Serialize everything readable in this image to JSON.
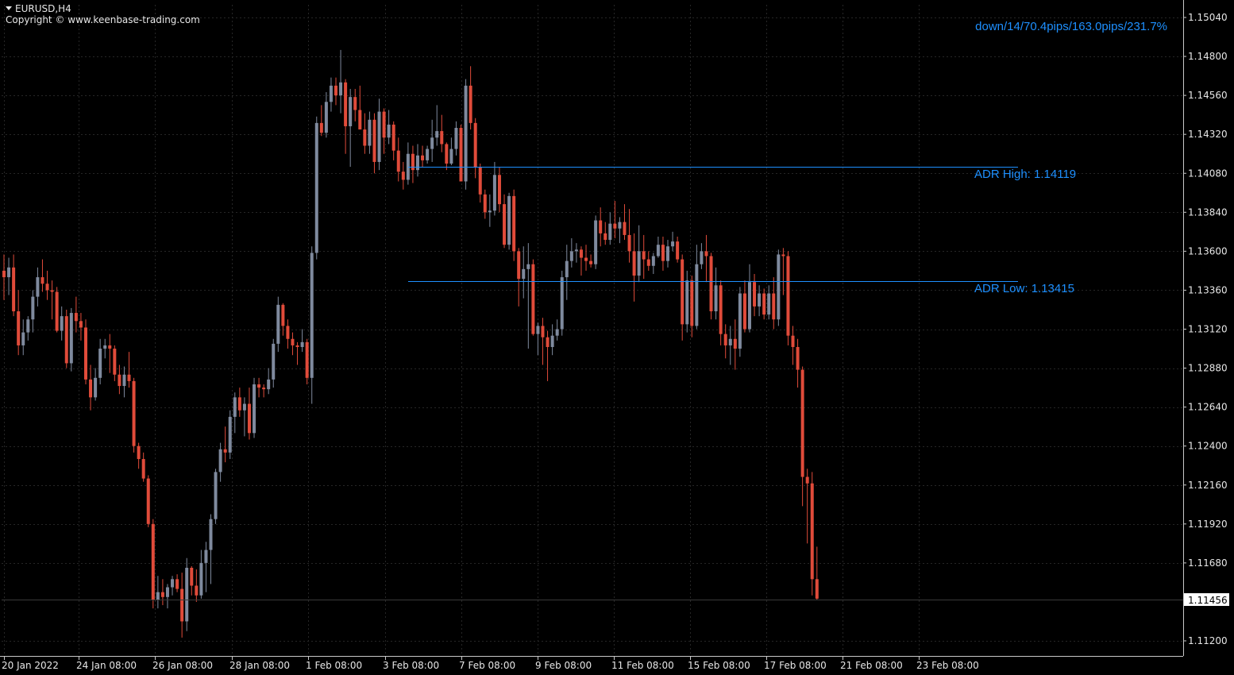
{
  "header": {
    "symbol_label": "EURUSD,H4",
    "copyright": "Copyright © www.keenbase-trading.com"
  },
  "indicator": {
    "status": "down/14/70.4pips/163.0pips/231.7%",
    "adr_high_label": "ADR High: 1.14119",
    "adr_low_label": "ADR Low: 1.13415",
    "adr_high": 1.14119,
    "adr_low": 1.13415
  },
  "current_price": "1.11456",
  "colors": {
    "background": "#000000",
    "grid": "#262626",
    "axis": "#c8c8c8",
    "text": "#e6e6e6",
    "bull": "#7f8a9e",
    "bear": "#e04b3a",
    "adr": "#1e90ff"
  },
  "chart_data": {
    "type": "candlestick",
    "symbol": "EURUSD",
    "timeframe": "H4",
    "ylim": [
      1.1112,
      1.1514
    ],
    "y_ticks": [
      "1.15040",
      "1.14800",
      "1.14560",
      "1.14320",
      "1.14080",
      "1.13840",
      "1.13600",
      "1.13360",
      "1.13120",
      "1.12880",
      "1.12640",
      "1.12400",
      "1.12160",
      "1.11920",
      "1.11680",
      "1.11200"
    ],
    "x_ticks": [
      "20 Jan 2022",
      "24 Jan 08:00",
      "26 Jan 08:00",
      "28 Jan 08:00",
      "1 Feb 08:00",
      "3 Feb 08:00",
      "7 Feb 08:00",
      "9 Feb 08:00",
      "11 Feb 08:00",
      "15 Feb 08:00",
      "17 Feb 08:00",
      "21 Feb 08:00",
      "23 Feb 08:00"
    ],
    "candles": [
      [
        1.1348,
        1.1358,
        1.133,
        1.1344
      ],
      [
        1.1344,
        1.1356,
        1.1333,
        1.135
      ],
      [
        1.135,
        1.1358,
        1.132,
        1.1323
      ],
      [
        1.1323,
        1.1336,
        1.1296,
        1.1302
      ],
      [
        1.1302,
        1.1318,
        1.1296,
        1.131
      ],
      [
        1.131,
        1.132,
        1.1305,
        1.1318
      ],
      [
        1.1318,
        1.1336,
        1.131,
        1.1332
      ],
      [
        1.1332,
        1.135,
        1.1326,
        1.1344
      ],
      [
        1.1344,
        1.1355,
        1.1335,
        1.134
      ],
      [
        1.134,
        1.1348,
        1.133,
        1.1336
      ],
      [
        1.1336,
        1.1342,
        1.1318,
        1.1335
      ],
      [
        1.1335,
        1.1338,
        1.131,
        1.1311
      ],
      [
        1.1311,
        1.1326,
        1.1305,
        1.132
      ],
      [
        1.132,
        1.1324,
        1.1288,
        1.1291
      ],
      [
        1.1291,
        1.1325,
        1.1286,
        1.1322
      ],
      [
        1.1322,
        1.1332,
        1.131,
        1.1317
      ],
      [
        1.1317,
        1.1322,
        1.1305,
        1.1313
      ],
      [
        1.1313,
        1.1318,
        1.1278,
        1.1281
      ],
      [
        1.1281,
        1.129,
        1.1262,
        1.127
      ],
      [
        1.127,
        1.1288,
        1.1268,
        1.1282
      ],
      [
        1.1282,
        1.1306,
        1.1278,
        1.13
      ],
      [
        1.13,
        1.1306,
        1.1294,
        1.1302
      ],
      [
        1.1302,
        1.1309,
        1.1285,
        1.13
      ],
      [
        1.13,
        1.1302,
        1.128,
        1.1284
      ],
      [
        1.1284,
        1.129,
        1.1272,
        1.1277
      ],
      [
        1.1277,
        1.1289,
        1.127,
        1.1284
      ],
      [
        1.1284,
        1.1298,
        1.1276,
        1.128
      ],
      [
        1.128,
        1.1282,
        1.1236,
        1.124
      ],
      [
        1.124,
        1.1242,
        1.1226,
        1.1232
      ],
      [
        1.1232,
        1.1236,
        1.1218,
        1.122
      ],
      [
        1.122,
        1.1222,
        1.119,
        1.1192
      ],
      [
        1.1192,
        1.1195,
        1.114,
        1.1145
      ],
      [
        1.1145,
        1.116,
        1.114,
        1.115
      ],
      [
        1.115,
        1.1158,
        1.1142,
        1.1147
      ],
      [
        1.1147,
        1.1155,
        1.114,
        1.1153
      ],
      [
        1.1153,
        1.116,
        1.1148,
        1.1158
      ],
      [
        1.1158,
        1.1161,
        1.115,
        1.1152
      ],
      [
        1.1152,
        1.1162,
        1.1122,
        1.1132
      ],
      [
        1.1132,
        1.1171,
        1.1126,
        1.1165
      ],
      [
        1.1165,
        1.1166,
        1.1148,
        1.1154
      ],
      [
        1.1154,
        1.1164,
        1.1144,
        1.1148
      ],
      [
        1.1148,
        1.1176,
        1.1146,
        1.1168
      ],
      [
        1.1168,
        1.1181,
        1.115,
        1.1176
      ],
      [
        1.1176,
        1.1198,
        1.1155,
        1.1195
      ],
      [
        1.1195,
        1.1226,
        1.1192,
        1.1224
      ],
      [
        1.1224,
        1.1242,
        1.1218,
        1.1238
      ],
      [
        1.1238,
        1.1252,
        1.123,
        1.1236
      ],
      [
        1.1236,
        1.1262,
        1.1232,
        1.1258
      ],
      [
        1.1258,
        1.1273,
        1.1248,
        1.127
      ],
      [
        1.127,
        1.1276,
        1.1258,
        1.1262
      ],
      [
        1.1262,
        1.127,
        1.1246,
        1.1266
      ],
      [
        1.1266,
        1.1276,
        1.1244,
        1.1248
      ],
      [
        1.1248,
        1.1282,
        1.1245,
        1.1278
      ],
      [
        1.1278,
        1.1282,
        1.127,
        1.1276
      ],
      [
        1.1276,
        1.1278,
        1.127,
        1.1275
      ],
      [
        1.1275,
        1.1288,
        1.1272,
        1.1281
      ],
      [
        1.1281,
        1.1306,
        1.1276,
        1.1303
      ],
      [
        1.1303,
        1.1332,
        1.1298,
        1.1327
      ],
      [
        1.1327,
        1.1328,
        1.1308,
        1.1314
      ],
      [
        1.1314,
        1.1318,
        1.13,
        1.1306
      ],
      [
        1.1306,
        1.131,
        1.1296,
        1.1302
      ],
      [
        1.1302,
        1.1304,
        1.129,
        1.1301
      ],
      [
        1.1301,
        1.1312,
        1.1298,
        1.1304
      ],
      [
        1.1304,
        1.1306,
        1.1278,
        1.1282
      ],
      [
        1.1282,
        1.1363,
        1.1266,
        1.1359
      ],
      [
        1.1359,
        1.1443,
        1.1355,
        1.1439
      ],
      [
        1.1439,
        1.145,
        1.1431,
        1.1433
      ],
      [
        1.1433,
        1.1458,
        1.143,
        1.1452
      ],
      [
        1.1452,
        1.1467,
        1.1446,
        1.1462
      ],
      [
        1.1462,
        1.1467,
        1.145,
        1.1456
      ],
      [
        1.1456,
        1.1484,
        1.1445,
        1.1464
      ],
      [
        1.1464,
        1.1466,
        1.142,
        1.1437
      ],
      [
        1.1437,
        1.146,
        1.1412,
        1.1455
      ],
      [
        1.1455,
        1.146,
        1.144,
        1.1447
      ],
      [
        1.1447,
        1.1462,
        1.1437,
        1.1435
      ],
      [
        1.1435,
        1.1445,
        1.142,
        1.1425
      ],
      [
        1.1425,
        1.1446,
        1.142,
        1.1441
      ],
      [
        1.1441,
        1.1445,
        1.1408,
        1.1415
      ],
      [
        1.1415,
        1.1454,
        1.141,
        1.1446
      ],
      [
        1.1446,
        1.1448,
        1.142,
        1.143
      ],
      [
        1.143,
        1.1447,
        1.1426,
        1.1438
      ],
      [
        1.1438,
        1.144,
        1.1416,
        1.1422
      ],
      [
        1.1422,
        1.143,
        1.1403,
        1.1409
      ],
      [
        1.1409,
        1.1415,
        1.1398,
        1.1404
      ],
      [
        1.1404,
        1.1427,
        1.1401,
        1.142
      ],
      [
        1.142,
        1.1425,
        1.1402,
        1.141
      ],
      [
        1.141,
        1.1426,
        1.1406,
        1.1419
      ],
      [
        1.1419,
        1.1425,
        1.1412,
        1.1416
      ],
      [
        1.1416,
        1.1425,
        1.1414,
        1.1423
      ],
      [
        1.1423,
        1.1441,
        1.1415,
        1.143
      ],
      [
        1.143,
        1.145,
        1.1425,
        1.1434
      ],
      [
        1.1434,
        1.1444,
        1.1421,
        1.1426
      ],
      [
        1.1426,
        1.1427,
        1.141,
        1.1414
      ],
      [
        1.1414,
        1.143,
        1.1413,
        1.1423
      ],
      [
        1.1423,
        1.144,
        1.1419,
        1.1436
      ],
      [
        1.1436,
        1.1438,
        1.1421,
        1.1403
      ],
      [
        1.1403,
        1.1466,
        1.1398,
        1.1462
      ],
      [
        1.1462,
        1.1474,
        1.1435,
        1.1439
      ],
      [
        1.1439,
        1.1442,
        1.1405,
        1.1412
      ],
      [
        1.1412,
        1.1414,
        1.139,
        1.1395
      ],
      [
        1.1395,
        1.1398,
        1.138,
        1.1384
      ],
      [
        1.1384,
        1.1395,
        1.1375,
        1.1385
      ],
      [
        1.1385,
        1.1415,
        1.1382,
        1.1407
      ],
      [
        1.1407,
        1.1412,
        1.1384,
        1.1389
      ],
      [
        1.1389,
        1.1395,
        1.1362,
        1.1364
      ],
      [
        1.1364,
        1.1396,
        1.1361,
        1.1394
      ],
      [
        1.1394,
        1.1398,
        1.1354,
        1.136
      ],
      [
        1.136,
        1.1362,
        1.1326,
        1.1343
      ],
      [
        1.1343,
        1.1363,
        1.1331,
        1.1349
      ],
      [
        1.1349,
        1.1365,
        1.13,
        1.1352
      ],
      [
        1.1352,
        1.1355,
        1.1308,
        1.1309
      ],
      [
        1.1309,
        1.1316,
        1.1296,
        1.1314
      ],
      [
        1.1314,
        1.1319,
        1.129,
        1.1307
      ],
      [
        1.1307,
        1.1311,
        1.128,
        1.1301
      ],
      [
        1.1301,
        1.1315,
        1.1296,
        1.1308
      ],
      [
        1.1308,
        1.1318,
        1.1305,
        1.1312
      ],
      [
        1.1312,
        1.1348,
        1.1308,
        1.1344
      ],
      [
        1.1344,
        1.1364,
        1.133,
        1.1354
      ],
      [
        1.1354,
        1.1368,
        1.135,
        1.136
      ],
      [
        1.136,
        1.1365,
        1.1353,
        1.1361
      ],
      [
        1.1361,
        1.1363,
        1.1345,
        1.1356
      ],
      [
        1.1356,
        1.1364,
        1.1348,
        1.1354
      ],
      [
        1.1354,
        1.1358,
        1.135,
        1.1352
      ],
      [
        1.1352,
        1.1382,
        1.1349,
        1.1379
      ],
      [
        1.1379,
        1.1387,
        1.1363,
        1.1371
      ],
      [
        1.1371,
        1.1378,
        1.1364,
        1.1367
      ],
      [
        1.1367,
        1.1384,
        1.1364,
        1.1377
      ],
      [
        1.1377,
        1.1391,
        1.1368,
        1.1374
      ],
      [
        1.1374,
        1.1381,
        1.1365,
        1.1378
      ],
      [
        1.1378,
        1.1389,
        1.1367,
        1.137
      ],
      [
        1.137,
        1.1386,
        1.1353,
        1.136
      ],
      [
        1.136,
        1.1371,
        1.1329,
        1.1345
      ],
      [
        1.1345,
        1.1376,
        1.1341,
        1.136
      ],
      [
        1.136,
        1.137,
        1.1343,
        1.1355
      ],
      [
        1.1355,
        1.136,
        1.1348,
        1.1351
      ],
      [
        1.1351,
        1.1359,
        1.1346,
        1.1357
      ],
      [
        1.1357,
        1.1369,
        1.1356,
        1.1364
      ],
      [
        1.1364,
        1.1369,
        1.1348,
        1.1354
      ],
      [
        1.1354,
        1.1367,
        1.135,
        1.1363
      ],
      [
        1.1363,
        1.1372,
        1.136,
        1.1366
      ],
      [
        1.1366,
        1.1369,
        1.1353,
        1.1355
      ],
      [
        1.1355,
        1.1358,
        1.1305,
        1.1315
      ],
      [
        1.1315,
        1.1348,
        1.131,
        1.1342
      ],
      [
        1.1342,
        1.1345,
        1.1307,
        1.1314
      ],
      [
        1.1314,
        1.1364,
        1.1312,
        1.1352
      ],
      [
        1.1352,
        1.1365,
        1.1349,
        1.136
      ],
      [
        1.136,
        1.137,
        1.1341,
        1.1357
      ],
      [
        1.1357,
        1.1359,
        1.1318,
        1.1323
      ],
      [
        1.1323,
        1.135,
        1.1318,
        1.1339
      ],
      [
        1.1339,
        1.1342,
        1.1302,
        1.1309
      ],
      [
        1.1309,
        1.1315,
        1.1294,
        1.1302
      ],
      [
        1.1302,
        1.1314,
        1.129,
        1.1306
      ],
      [
        1.1306,
        1.1318,
        1.1287,
        1.13
      ],
      [
        1.13,
        1.1338,
        1.1295,
        1.1334
      ],
      [
        1.1334,
        1.1342,
        1.131,
        1.1312
      ],
      [
        1.1312,
        1.1352,
        1.131,
        1.1341
      ],
      [
        1.1341,
        1.1346,
        1.132,
        1.1326
      ],
      [
        1.1326,
        1.1339,
        1.132,
        1.1334
      ],
      [
        1.1334,
        1.1337,
        1.1318,
        1.1321
      ],
      [
        1.1321,
        1.1339,
        1.1318,
        1.1334
      ],
      [
        1.1334,
        1.1344,
        1.1312,
        1.1318
      ],
      [
        1.1318,
        1.1361,
        1.1314,
        1.1358
      ],
      [
        1.1358,
        1.1362,
        1.1333,
        1.1357
      ],
      [
        1.1357,
        1.136,
        1.1302,
        1.1308
      ],
      [
        1.1308,
        1.1314,
        1.129,
        1.1301
      ],
      [
        1.1301,
        1.1306,
        1.1276,
        1.1287
      ],
      [
        1.1287,
        1.1289,
        1.1203,
        1.1221
      ],
      [
        1.1221,
        1.1226,
        1.118,
        1.1217
      ],
      [
        1.1217,
        1.1224,
        1.1148,
        1.1158
      ],
      [
        1.1158,
        1.1178,
        1.1145,
        1.1146
      ]
    ]
  }
}
